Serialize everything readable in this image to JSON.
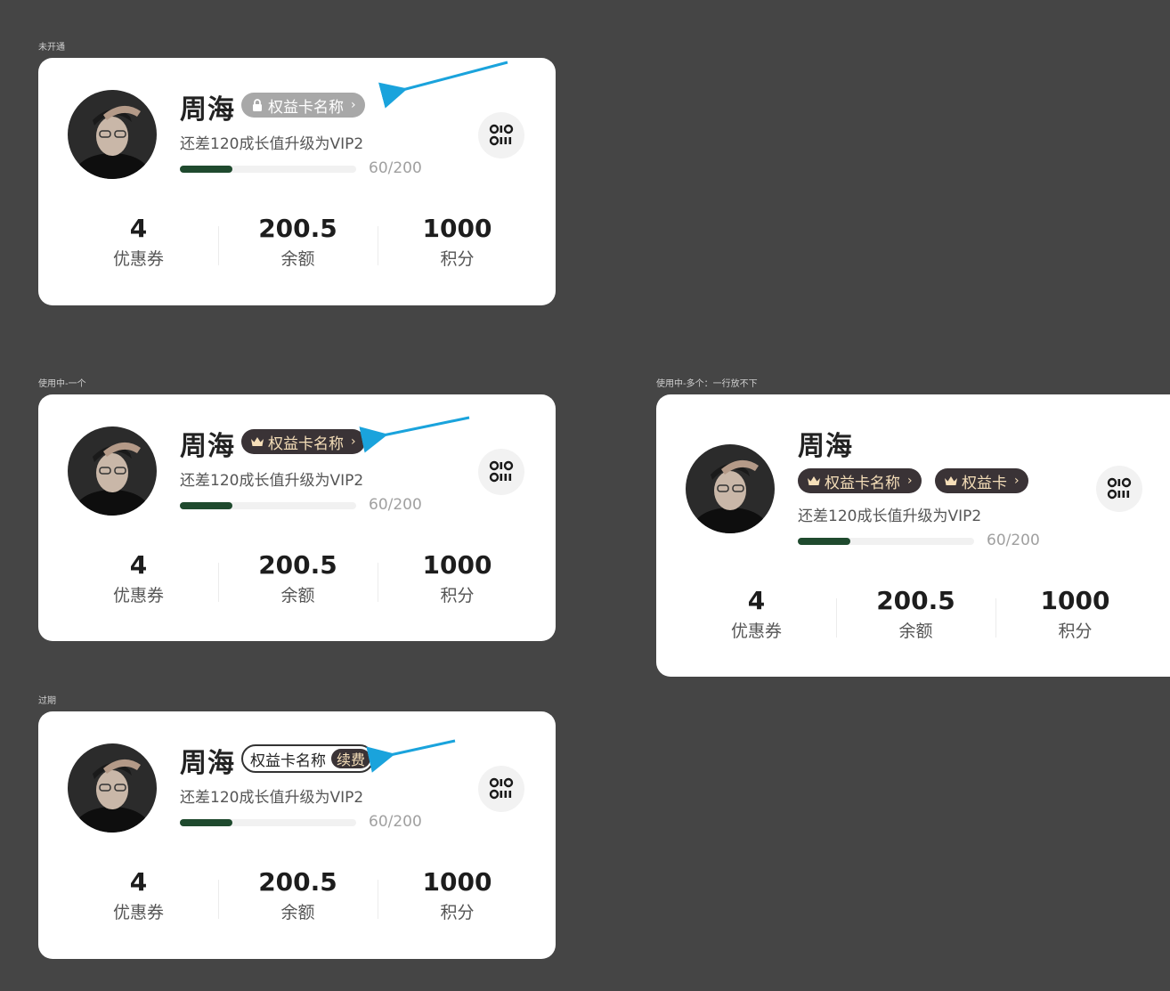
{
  "states": {
    "locked_label": "未开通",
    "active_one_label": "使用中-一个",
    "active_multi_label": "使用中-多个：一行放不下",
    "expired_label": "过期"
  },
  "user": {
    "name": "周海",
    "upgrade_text": "还差120成长值升级为VIP2",
    "progress_text": "60/200",
    "progress_value": 60,
    "progress_max": 200
  },
  "benefit_card": {
    "name": "权益卡名称",
    "short_name": "权益卡",
    "renew_label": "续费",
    "chevron": "›"
  },
  "stats": [
    {
      "value": "4",
      "label": "优惠券"
    },
    {
      "value": "200.5",
      "label": "余额"
    },
    {
      "value": "1000",
      "label": "积分"
    }
  ],
  "colors": {
    "progress_fill": "#1f4a2e",
    "badge_active_bg": "#3a3336",
    "badge_active_text": "#f6dfb9",
    "badge_locked_bg": "#a8a8a8",
    "arrow": "#1aa3dc"
  },
  "icons": {
    "lock": "lock-icon",
    "crown": "crown-icon",
    "qr": "qr-code-icon"
  }
}
